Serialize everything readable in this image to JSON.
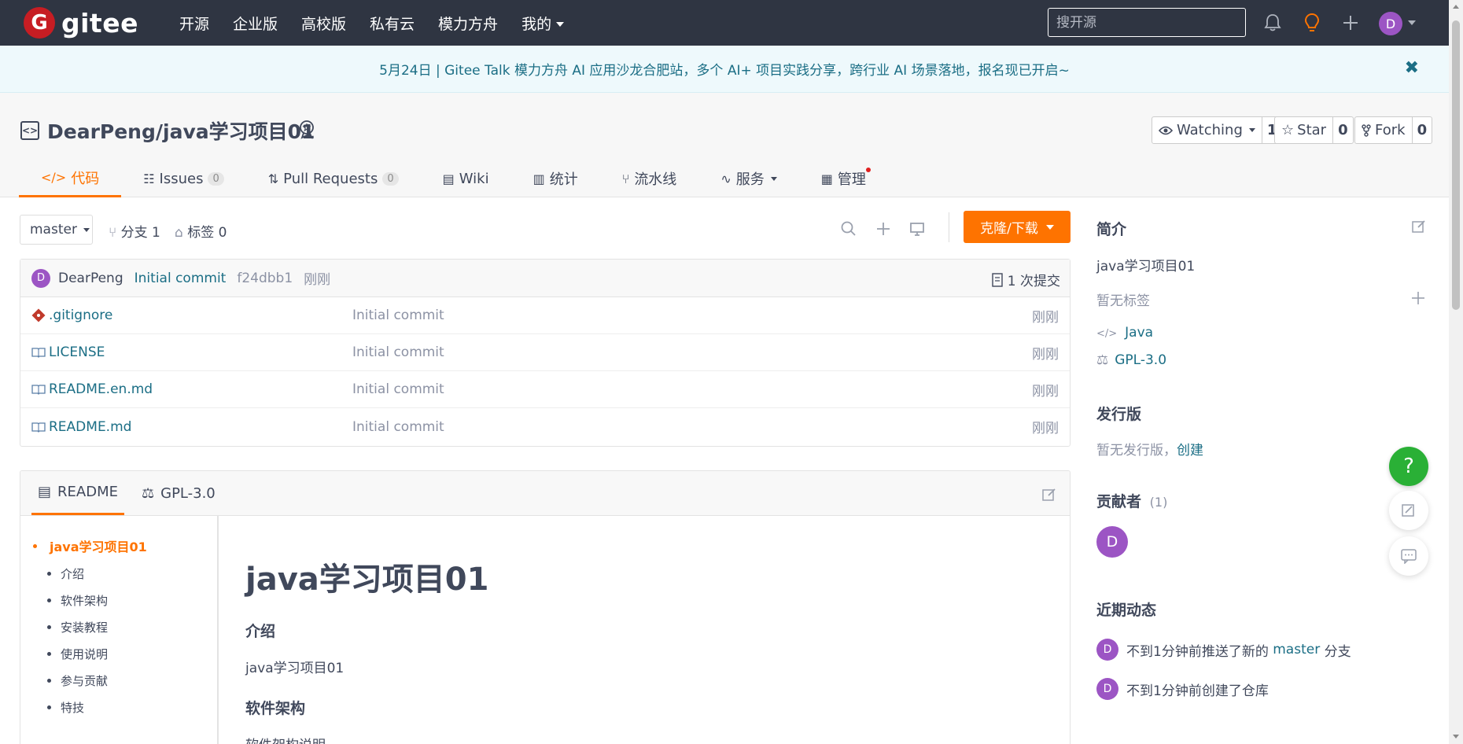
{
  "colors": {
    "brand": "#c71d23",
    "accent": "#fe7300",
    "nav_bg": "#2f3542",
    "link": "#1b6e85",
    "avatar": "#9c55c4",
    "help": "#2ab036"
  },
  "topnav": {
    "logo_text": "gitee",
    "logo_badge": "G",
    "links": [
      "开源",
      "企业版",
      "高校版",
      "私有云",
      "模力方舟",
      "我的"
    ],
    "search_placeholder": "搜开源",
    "avatar_letter": "D",
    "icons": [
      "bell-icon",
      "lightbulb-icon",
      "plus-icon"
    ]
  },
  "announcement": {
    "text": "5月24日 | Gitee Talk 模力方舟 AI 应用沙龙合肥站，多个 AI+ 项目实践分享，跨行业 AI 场景落地，报名现已开启~",
    "close": "✖"
  },
  "repo": {
    "title": "DearPeng/java学习项目01",
    "watching": {
      "label": "Watching",
      "count": "1"
    },
    "star": {
      "label": "Star",
      "count": "0"
    },
    "fork": {
      "label": "Fork",
      "count": "0"
    },
    "tabs": [
      {
        "label": "代码",
        "count": ""
      },
      {
        "label": "Issues",
        "count": "0"
      },
      {
        "label": "Pull Requests",
        "count": "0"
      },
      {
        "label": "Wiki",
        "count": ""
      },
      {
        "label": "统计",
        "count": ""
      },
      {
        "label": "流水线",
        "count": ""
      },
      {
        "label": "服务",
        "count": ""
      },
      {
        "label": "管理",
        "count": ""
      }
    ]
  },
  "toolbar": {
    "branch": "master",
    "branches": "分支 1",
    "tags": "标签 0",
    "clone_label": "克隆/下载"
  },
  "commit": {
    "avatar_letter": "D",
    "author": "DearPeng",
    "message": "Initial commit",
    "hash": "f24dbb1",
    "time": "刚刚",
    "count": "1 次提交"
  },
  "files": [
    {
      "name": ".gitignore",
      "icon": "git-icon",
      "commit": "Initial commit",
      "time": "刚刚"
    },
    {
      "name": "LICENSE",
      "icon": "book-icon",
      "commit": "Initial commit",
      "time": "刚刚"
    },
    {
      "name": "README.en.md",
      "icon": "book-icon",
      "commit": "Initial commit",
      "time": "刚刚"
    },
    {
      "name": "README.md",
      "icon": "book-icon",
      "commit": "Initial commit",
      "time": "刚刚"
    }
  ],
  "readme": {
    "tabs": [
      "README",
      "GPL-3.0"
    ],
    "toc": [
      "java学习项目01",
      "介绍",
      "软件架构",
      "安装教程",
      "使用说明",
      "参与贡献",
      "特技"
    ],
    "h1": "java学习项目01",
    "sections": [
      {
        "heading": "介绍",
        "text": "java学习项目01"
      },
      {
        "heading": "软件架构",
        "text": "软件架构说明"
      }
    ]
  },
  "sidebar": {
    "intro_title": "简介",
    "intro_text": "java学习项目01",
    "no_tags": "暂无标签",
    "language": "Java",
    "license": "GPL-3.0",
    "release_title": "发行版",
    "release_text": "暂无发行版，",
    "release_create": "创建",
    "contributors_title": "贡献者",
    "contributors_count": "(1)",
    "contributor_letter": "D",
    "activity_title": "近期动态",
    "activities": [
      {
        "letter": "D",
        "before": "不到1分钟前推送了新的 ",
        "link": "master",
        "after": " 分支"
      },
      {
        "letter": "D",
        "before": "不到1分钟前创建了仓库",
        "link": "",
        "after": ""
      }
    ]
  },
  "floating": {
    "help": "?"
  }
}
